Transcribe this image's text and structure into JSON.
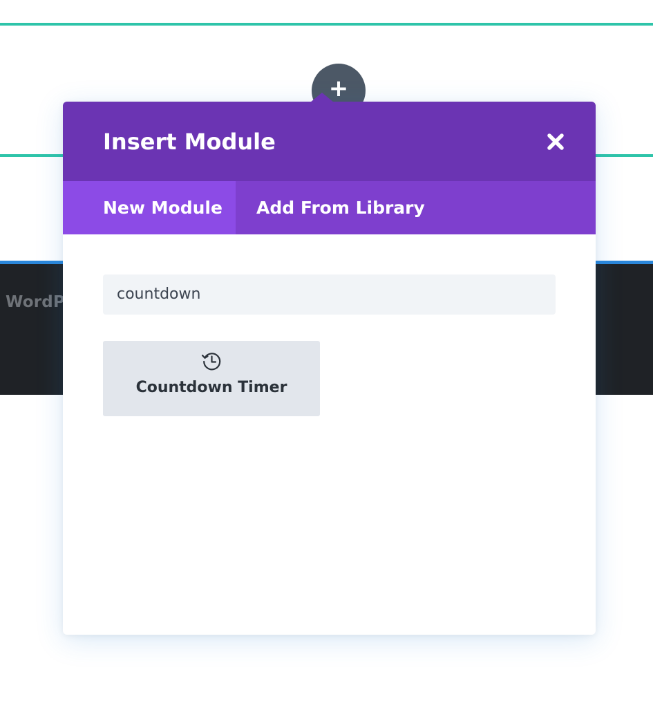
{
  "background": {
    "page_text_fragment": "WordP"
  },
  "modal": {
    "title": "Insert Module",
    "close_icon": "close-icon",
    "tabs": [
      {
        "label": "New Module",
        "active": true
      },
      {
        "label": "Add From Library",
        "active": false
      }
    ],
    "search": {
      "value": "countdown",
      "placeholder": ""
    },
    "results": [
      {
        "label": "Countdown Timer",
        "icon": "history-clock-icon"
      }
    ]
  },
  "colors": {
    "header": "#6b34b3",
    "tab_bar": "#7e3fce",
    "tab_active": "#8c4be6",
    "teal_lines": "#2ec4a9",
    "dark_band": "#1f2226",
    "blue_accent": "#2b87da",
    "add_circle": "#4c5866"
  }
}
